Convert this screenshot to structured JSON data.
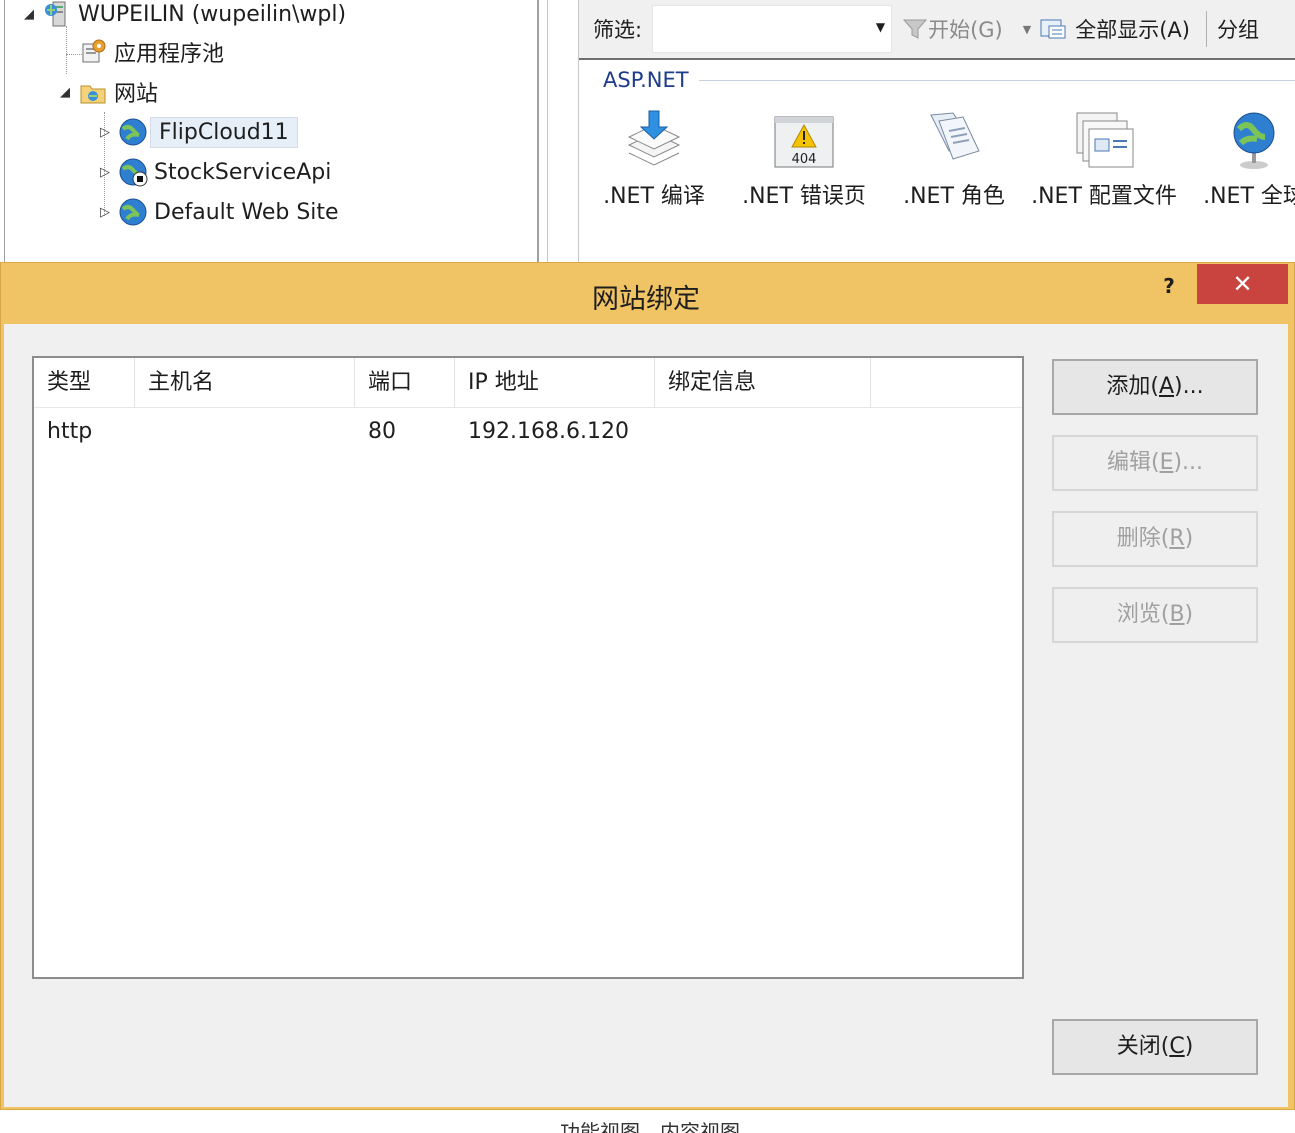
{
  "tree": {
    "server": "WUPEILIN (wupeilin\\wpl)",
    "app_pools": "应用程序池",
    "sites_folder": "网站",
    "sites": [
      {
        "name": "FlipCloud11",
        "selected": true
      },
      {
        "name": "StockServiceApi",
        "selected": false
      },
      {
        "name": "Default Web Site",
        "selected": false
      }
    ]
  },
  "features": {
    "filter_label": "筛选:",
    "filter_value": "",
    "go_button": "开始(G)",
    "show_all_button": "全部显示(A)",
    "group_by_button": "分组",
    "group_name": "ASP.NET",
    "items": [
      {
        "label": ".NET 编译",
        "icon": "compile-icon"
      },
      {
        "label": ".NET 错误页",
        "icon": "error-page-icon"
      },
      {
        "label": ".NET 角色",
        "icon": "roles-icon"
      },
      {
        "label": ".NET 配置文件",
        "icon": "profile-icon"
      },
      {
        "label": ".NET 全球",
        "icon": "globe-icon"
      }
    ]
  },
  "bottom_tabs": [
    "功能视图",
    "内容视图"
  ],
  "dialog": {
    "title": "网站绑定",
    "help": "?",
    "close": "✕",
    "columns": [
      "类型",
      "主机名",
      "端口",
      "IP 地址",
      "绑定信息"
    ],
    "rows": [
      {
        "type": "http",
        "host": "",
        "port": "80",
        "ip": "192.168.6.120",
        "info": ""
      }
    ],
    "buttons": {
      "add": {
        "label": "添加(",
        "key": "A",
        "suffix": ")...",
        "enabled": true
      },
      "edit": {
        "label": "编辑(",
        "key": "E",
        "suffix": ")...",
        "enabled": false
      },
      "remove": {
        "label": "删除(",
        "key": "R",
        "suffix": ")",
        "enabled": false
      },
      "browse": {
        "label": "浏览(",
        "key": "B",
        "suffix": ")",
        "enabled": false
      },
      "close": {
        "label": "关闭(",
        "key": "C",
        "suffix": ")",
        "enabled": true
      }
    },
    "colors": {
      "titlebar": "#f0c364",
      "close_button": "#c9443f",
      "group_header": "#1e3b8c"
    }
  }
}
